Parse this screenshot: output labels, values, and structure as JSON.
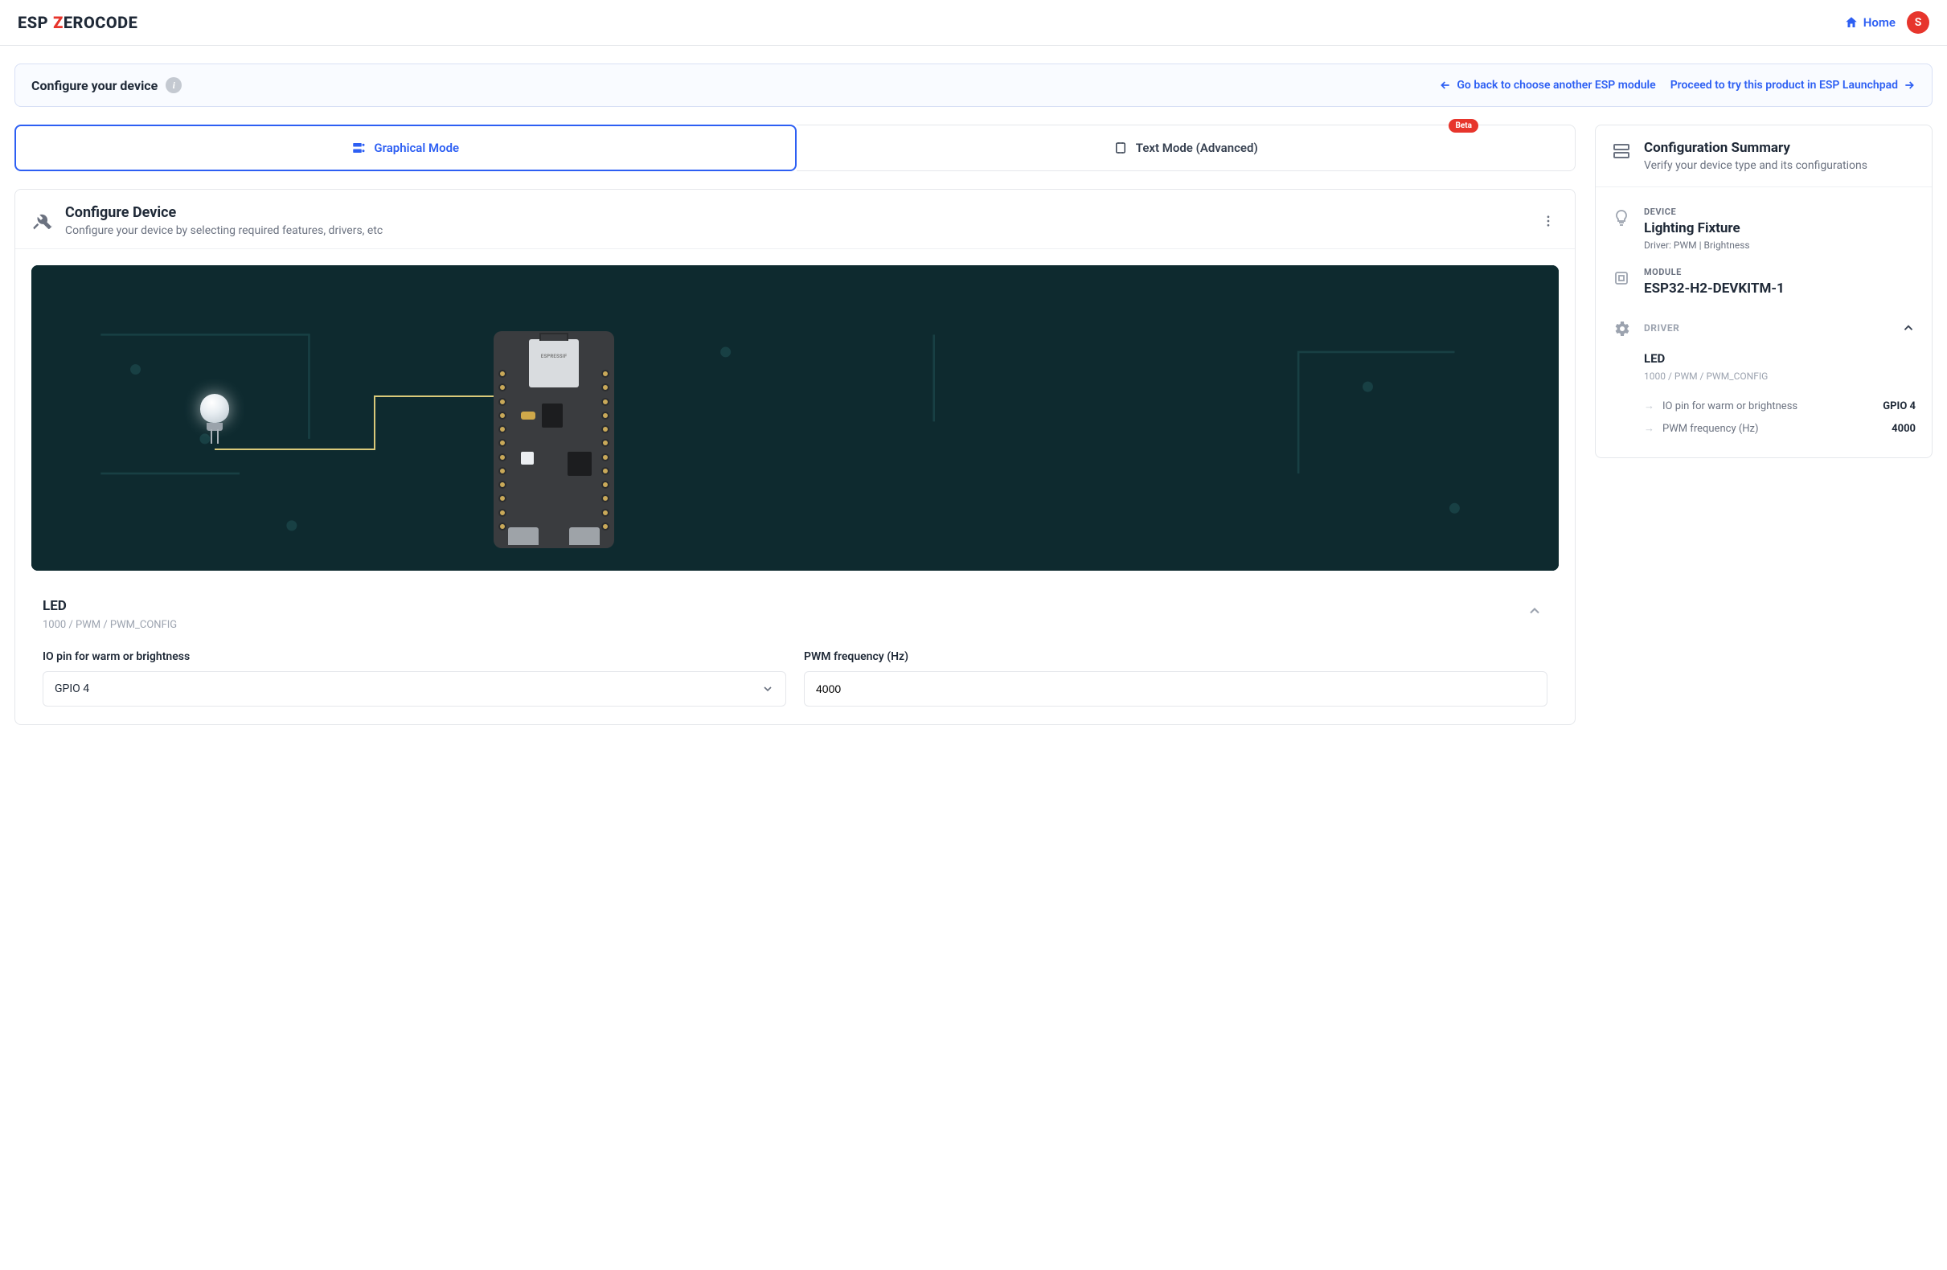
{
  "header": {
    "logo_part1": "ESP",
    "logo_z": "Z",
    "logo_part2": "EROCODE",
    "home_label": "Home",
    "avatar_initial": "S"
  },
  "top_bar": {
    "title": "Configure your device",
    "back_link": "Go back to choose another ESP module",
    "proceed_link": "Proceed to try this product in ESP Launchpad"
  },
  "tabs": {
    "graphical": "Graphical Mode",
    "text": "Text Mode (Advanced)",
    "beta_badge": "Beta"
  },
  "configure": {
    "title": "Configure Device",
    "subtitle": "Configure your device by selecting required features, drivers, etc",
    "chip_label": "ESPRESSIF"
  },
  "driver_panel": {
    "name": "LED",
    "path": "1000 / PWM / PWM_CONFIG",
    "field_io_label": "IO pin for warm or brightness",
    "field_io_value": "GPIO 4",
    "field_pwm_label": "PWM frequency (Hz)",
    "field_pwm_value": "4000"
  },
  "summary": {
    "title": "Configuration Summary",
    "subtitle": "Verify your device type and its configurations",
    "device_label": "DEVICE",
    "device_name": "Lighting Fixture",
    "device_meta": "Driver: PWM | Brightness",
    "module_label": "MODULE",
    "module_name": "ESP32-H2-DEVKITM-1",
    "driver_label": "DRIVER",
    "driver_name": "LED",
    "driver_path": "1000 / PWM / PWM_CONFIG",
    "kv1_k": "IO pin for warm or brightness",
    "kv1_v": "GPIO 4",
    "kv2_k": "PWM frequency (Hz)",
    "kv2_v": "4000"
  }
}
